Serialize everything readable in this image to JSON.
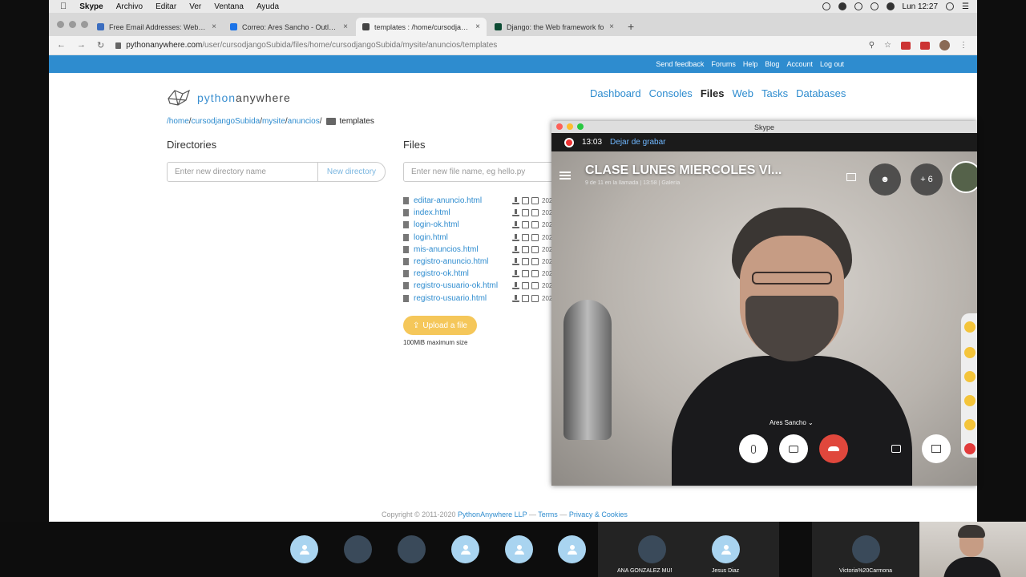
{
  "menubar": {
    "items": [
      "Skype",
      "Archivo",
      "Editar",
      "Ver",
      "Ventana",
      "Ayuda"
    ],
    "clock": "Lun 12:27"
  },
  "tabs": [
    {
      "label": "Free Email Addresses: Web ba",
      "favicon_color": "#3b6dbf",
      "active": false
    },
    {
      "label": "Correo: Ares Sancho - Outlook",
      "favicon_color": "#1a73e8",
      "active": false
    },
    {
      "label": "templates : /home/cursodjango",
      "favicon_color": "#444444",
      "active": true
    },
    {
      "label": "Django: the Web framework fo",
      "favicon_color": "#0c4b33",
      "active": false
    }
  ],
  "address": {
    "host": "pythonanywhere.com",
    "path": "/user/cursodjangoSubida/files/home/cursodjangoSubida/mysite/anuncios/templates"
  },
  "topnav": [
    "Send feedback",
    "Forums",
    "Help",
    "Blog",
    "Account",
    "Log out"
  ],
  "logo": {
    "py": "python",
    "aw": "anywhere"
  },
  "mainnav": {
    "items": [
      "Dashboard",
      "Consoles",
      "Files",
      "Web",
      "Tasks",
      "Databases"
    ],
    "active": "Files"
  },
  "breadcrumb": {
    "home": "/home",
    "user": "cursodjangoSubida",
    "site": "mysite",
    "app": "anuncios",
    "current": "templates"
  },
  "directories": {
    "heading": "Directories",
    "placeholder": "Enter new directory name",
    "button": "New directory"
  },
  "files": {
    "heading": "Files",
    "placeholder": "Enter new file name, eg hello.py",
    "items": [
      {
        "name": "editar-anuncio.html",
        "date": "202"
      },
      {
        "name": "index.html",
        "date": "202"
      },
      {
        "name": "login-ok.html",
        "date": "202"
      },
      {
        "name": "login.html",
        "date": "202"
      },
      {
        "name": "mis-anuncios.html",
        "date": "202"
      },
      {
        "name": "registro-anuncio.html",
        "date": "202"
      },
      {
        "name": "registro-ok.html",
        "date": "202"
      },
      {
        "name": "registro-usuario-ok.html",
        "date": "202"
      },
      {
        "name": "registro-usuario.html",
        "date": "202"
      }
    ],
    "upload_label": "Upload a file",
    "upload_note": "100MiB maximum size"
  },
  "footer": {
    "copyright": "Copyright © 2011-2020",
    "company": "PythonAnywhere LLP",
    "terms": "Terms",
    "privacy": "Privacy & Cookies"
  },
  "skype": {
    "window_title": "Skype",
    "rec_time": "13:03",
    "rec_stop": "Dejar de grabar",
    "call_title": "CLASE LUNES MIERCOLES VI...",
    "call_subtitle": "9 de 11 en la llamada | 13:58 | Galería",
    "add_count": "+ 6",
    "speaker": "Ares Sancho",
    "colors": {
      "end_call": "#e0473c",
      "record": "#e33333",
      "link": "#6fb7ff"
    }
  },
  "participants": [
    {
      "name": "",
      "type": "default"
    },
    {
      "name": "",
      "type": "photo"
    },
    {
      "name": "",
      "type": "photo"
    },
    {
      "name": "",
      "type": "default"
    },
    {
      "name": "",
      "type": "default"
    },
    {
      "name": "",
      "type": "default"
    },
    {
      "name": "ANA GONZALEZ MUNICIO",
      "type": "photo"
    },
    {
      "name": "Jesus Diaz",
      "type": "default"
    },
    {
      "name": "Victoria%20Carmona",
      "type": "photo"
    }
  ],
  "colors": {
    "accent": "#2e8ccf",
    "upload": "#f5c75a"
  }
}
